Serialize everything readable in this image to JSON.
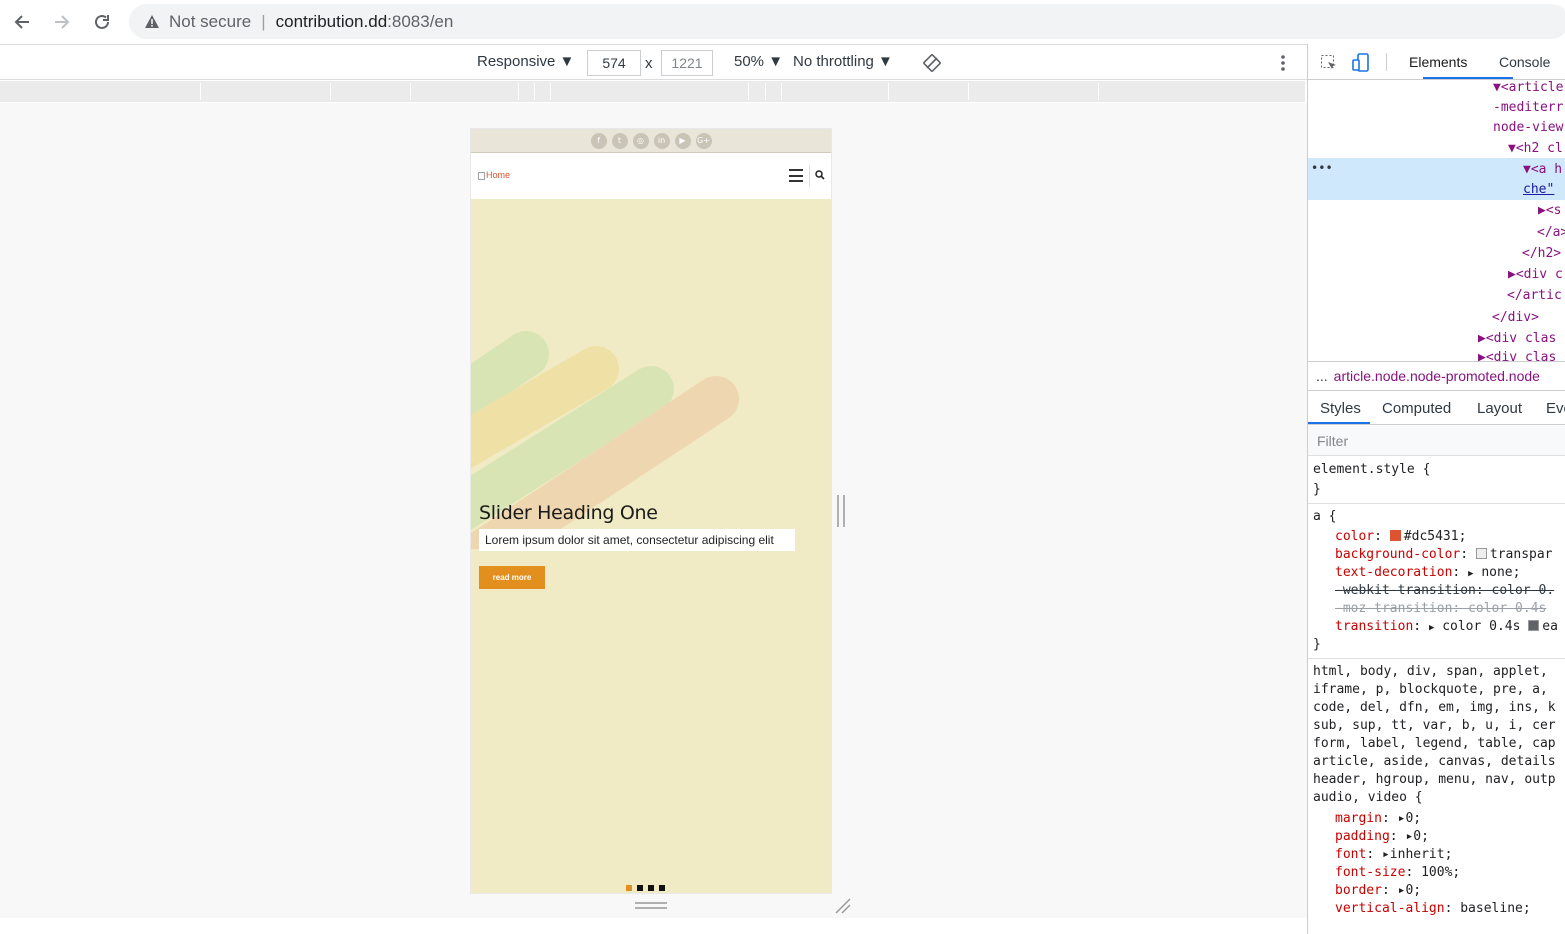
{
  "browser": {
    "security_label": "Not secure",
    "url_host": "contribution.dd",
    "url_rest": ":8083/en"
  },
  "device_toolbar": {
    "device": "Responsive ▼",
    "width": "574",
    "times": "x",
    "height": "1221",
    "zoom": "50% ▼",
    "throttling": "No throttling ▼"
  },
  "site": {
    "logo_alt": "Home",
    "social_icons": [
      "f",
      "t",
      "◎",
      "in",
      "▶",
      "G+"
    ],
    "slide_heading": "Slider Heading One",
    "slide_text": "Lorem ipsum dolor sit amet, consectetur adipiscing elit",
    "read_more": "read more",
    "slide_count": 4,
    "active_slide": 1
  },
  "devtools": {
    "tabs": [
      "Elements",
      "Console"
    ],
    "active_tab": "Elements",
    "dom_lines": [
      "▼<article",
      "-mediterr",
      "node-view",
      "▼<h2 cl",
      "▼<a h",
      "che\"",
      "▶<s",
      "</a>",
      "</h2>",
      "▶<div c",
      "</artic",
      "</div>",
      "▶<div clas",
      "▶<div clas"
    ],
    "breadcrumb": "article.node.node-promoted.node",
    "breadcrumb_ellipsis": "...",
    "row_ellipsis": "•••",
    "sub_tabs": [
      "Styles",
      "Computed",
      "Layout",
      "Eve"
    ],
    "filter_placeholder": "Filter",
    "element_style": [
      "element.style {",
      "}"
    ],
    "rule_a": {
      "selector": "a {",
      "color_prop": "color",
      "color_val": "#dc5431;",
      "bg_prop": "background-color",
      "bg_val": "transpar",
      "td_prop": "text-decoration",
      "td_val": "none;",
      "webkit": "-webkit-transition: color 0.",
      "moz": "-moz-transition: color 0.4s",
      "tr_prop": "transition",
      "tr_val": "color 0.4s",
      "tr_ease": "ea",
      "close": "}"
    },
    "reset_rule": {
      "selectors": [
        "html, body, div, span, applet,",
        "iframe, p, blockquote, pre, a,",
        "code, del, dfn, em, img, ins, k",
        "sub, sup, tt, var, b, u, i, cer",
        "form, label, legend, table, cap",
        "article, aside, canvas, details",
        "header, hgroup, menu, nav, outp",
        "audio, video {"
      ],
      "decls": [
        {
          "p": "margin",
          "v": "0;",
          "tri": true
        },
        {
          "p": "padding",
          "v": "0;",
          "tri": true
        },
        {
          "p": "font",
          "v": "inherit;",
          "tri": true
        },
        {
          "p": "font-size",
          "v": "100%;",
          "tri": false
        },
        {
          "p": "border",
          "v": "0;",
          "tri": true
        },
        {
          "p": "vertical-align",
          "v": "baseline;",
          "tri": false
        }
      ]
    }
  },
  "colors": {
    "accent": "#e28f1d",
    "link": "#dc5431",
    "slide_bg": "#f0ebc4",
    "devtools_blue": "#1a73e8"
  }
}
